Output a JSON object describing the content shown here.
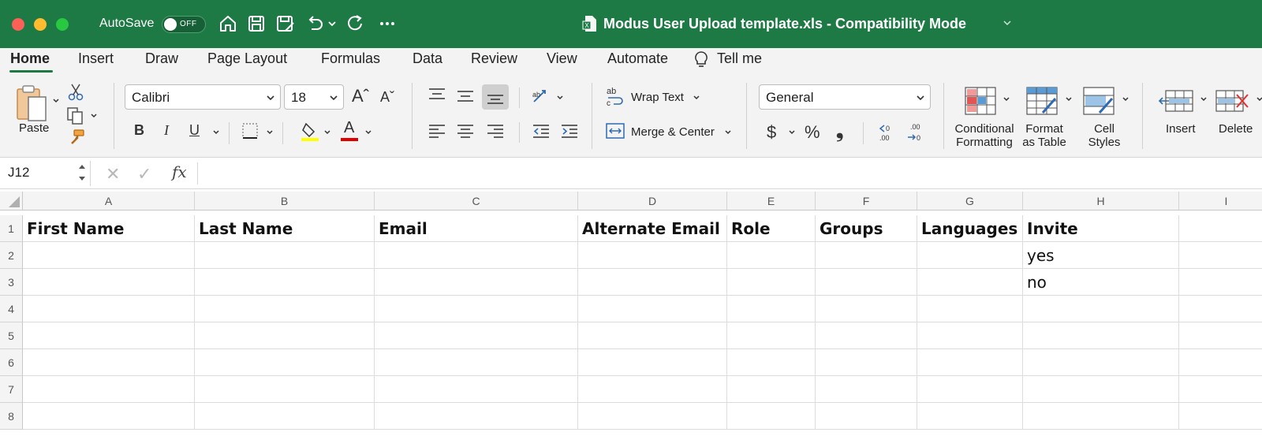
{
  "titlebar": {
    "autosave_label": "AutoSave",
    "autosave_state": "OFF",
    "file_title": "Modus User Upload template.xls  -  Compatibility Mode",
    "icons": [
      "home-icon",
      "save-icon",
      "save-as-icon",
      "undo-icon",
      "redo-icon",
      "more-icon"
    ]
  },
  "tabs": [
    {
      "label": "Home",
      "active": true
    },
    {
      "label": "Insert"
    },
    {
      "label": "Draw"
    },
    {
      "label": "Page Layout"
    },
    {
      "label": "Formulas"
    },
    {
      "label": "Data"
    },
    {
      "label": "Review"
    },
    {
      "label": "View"
    },
    {
      "label": "Automate"
    },
    {
      "label": "Tell me"
    }
  ],
  "ribbon": {
    "paste_label": "Paste",
    "font_name": "Calibri",
    "font_size": "18",
    "bold": "B",
    "italic": "I",
    "underline": "U",
    "font_color_letter": "A",
    "wrap_text": "Wrap Text",
    "merge_center": "Merge & Center",
    "number_format": "General",
    "currency": "$",
    "percent": "%",
    "comma": "❟",
    "conditional_formatting": [
      "Conditional",
      "Formatting"
    ],
    "format_as_table": [
      "Format",
      "as Table"
    ],
    "cell_styles": [
      "Cell",
      "Styles"
    ],
    "insert": "Insert",
    "delete": "Delete",
    "highlight_color": "#ffff00",
    "font_color": "#e00000"
  },
  "formula_bar": {
    "name_box": "J12",
    "fx": "fx",
    "content": ""
  },
  "grid": {
    "columns": [
      "A",
      "B",
      "C",
      "D",
      "E",
      "F",
      "G",
      "H",
      "I"
    ],
    "rows": [
      "1",
      "2",
      "3",
      "4",
      "5",
      "6",
      "7",
      "8"
    ],
    "cells": {
      "r1": [
        "First Name",
        "Last Name",
        "Email",
        "Alternate Email",
        "Role",
        "Groups",
        "Languages",
        "Invite",
        ""
      ],
      "r2": [
        "",
        "",
        "",
        "",
        "",
        "",
        "",
        "yes",
        ""
      ],
      "r3": [
        "",
        "",
        "",
        "",
        "",
        "",
        "",
        "no",
        ""
      ],
      "r4": [
        "",
        "",
        "",
        "",
        "",
        "",
        "",
        "",
        ""
      ],
      "r5": [
        "",
        "",
        "",
        "",
        "",
        "",
        "",
        "",
        ""
      ],
      "r6": [
        "",
        "",
        "",
        "",
        "",
        "",
        "",
        "",
        ""
      ],
      "r7": [
        "",
        "",
        "",
        "",
        "",
        "",
        "",
        "",
        ""
      ],
      "r8": [
        "",
        "",
        "",
        "",
        "",
        "",
        "",
        "",
        ""
      ]
    }
  },
  "colors": {
    "titlebar": "#1e7a45",
    "ribbon": "#f3f3f3"
  }
}
